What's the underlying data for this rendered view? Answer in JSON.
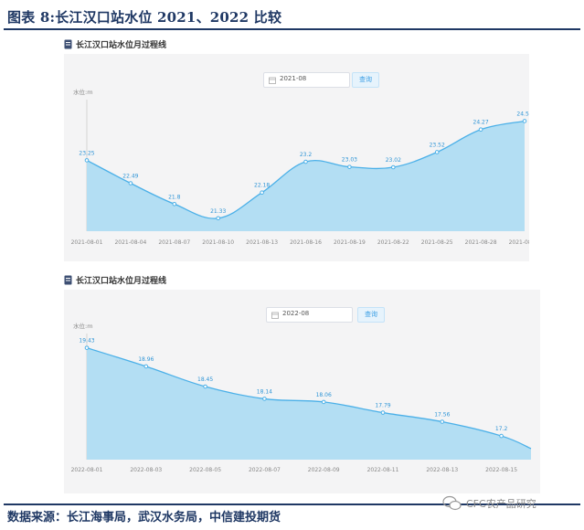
{
  "figure": {
    "title": "图表 8:长江汉口站水位 2021、2022 比较",
    "source": "数据来源：长江海事局，武汉水务局，中信建投期货",
    "watermark": "CFC农产品研究"
  },
  "colors": {
    "accent": "#1f3864",
    "area_fill": "#b3def3",
    "line": "#4bb0e8",
    "label": "#2f95d6",
    "button_text": "#3a9ee4"
  },
  "panels": [
    {
      "heading": "长江汉口站水位月过程线",
      "date_value": "2021-08",
      "query_label": "查询",
      "calendar_icon": "calendar-icon",
      "heading_icon": "document-icon"
    },
    {
      "heading": "长江汉口站水位月过程线",
      "date_value": "2022-08",
      "query_label": "查询",
      "calendar_icon": "calendar-icon",
      "heading_icon": "document-icon"
    }
  ],
  "chart_data": [
    {
      "type": "area",
      "title": "",
      "xlabel": "",
      "ylabel": "水位:m",
      "grid": false,
      "ylim": [
        20.9,
        25.2
      ],
      "x_ticks": [
        "2021-08-01",
        "2021-08-04",
        "2021-08-07",
        "2021-08-10",
        "2021-08-13",
        "2021-08-16",
        "2021-08-19",
        "2021-08-22",
        "2021-08-25",
        "2021-08-28",
        "2021-08-31"
      ],
      "points": [
        {
          "x": "2021-08-01",
          "y": 23.25,
          "label": "23.25"
        },
        {
          "x": "2021-08-04",
          "y": 22.49,
          "label": "22.49"
        },
        {
          "x": "2021-08-07",
          "y": 21.8,
          "label": "21.8"
        },
        {
          "x": "2021-08-10",
          "y": 21.33,
          "label": "21.33"
        },
        {
          "x": "2021-08-13",
          "y": 22.18,
          "label": "22.18"
        },
        {
          "x": "2021-08-16",
          "y": 23.2,
          "label": "23.2"
        },
        {
          "x": "2021-08-19",
          "y": 23.03,
          "label": "23.03"
        },
        {
          "x": "2021-08-22",
          "y": 23.02,
          "label": "23.02"
        },
        {
          "x": "2021-08-25",
          "y": 23.52,
          "label": "23.52"
        },
        {
          "x": "2021-08-28",
          "y": 24.27,
          "label": "24.27"
        },
        {
          "x": "2021-08-31",
          "y": 24.55,
          "label": "24.55"
        }
      ]
    },
    {
      "type": "area",
      "title": "",
      "xlabel": "",
      "ylabel": "水位:m",
      "grid": false,
      "ylim": [
        16.6,
        19.7
      ],
      "x_ticks": [
        "2022-08-01",
        "2022-08-03",
        "2022-08-05",
        "2022-08-07",
        "2022-08-09",
        "2022-08-11",
        "2022-08-13",
        "2022-08-15"
      ],
      "points": [
        {
          "x": "2022-08-01",
          "y": 19.43,
          "label": "19.43"
        },
        {
          "x": "2022-08-03",
          "y": 18.96,
          "label": "18.96"
        },
        {
          "x": "2022-08-05",
          "y": 18.45,
          "label": "18.45"
        },
        {
          "x": "2022-08-07",
          "y": 18.14,
          "label": "18.14"
        },
        {
          "x": "2022-08-09",
          "y": 18.06,
          "label": "18.06"
        },
        {
          "x": "2022-08-11",
          "y": 17.79,
          "label": "17.79"
        },
        {
          "x": "2022-08-13",
          "y": 17.56,
          "label": "17.56"
        },
        {
          "x": "2022-08-15",
          "y": 17.2,
          "label": "17.2"
        },
        {
          "x": "2022-08-16",
          "y": 16.88,
          "label": ""
        }
      ]
    }
  ]
}
